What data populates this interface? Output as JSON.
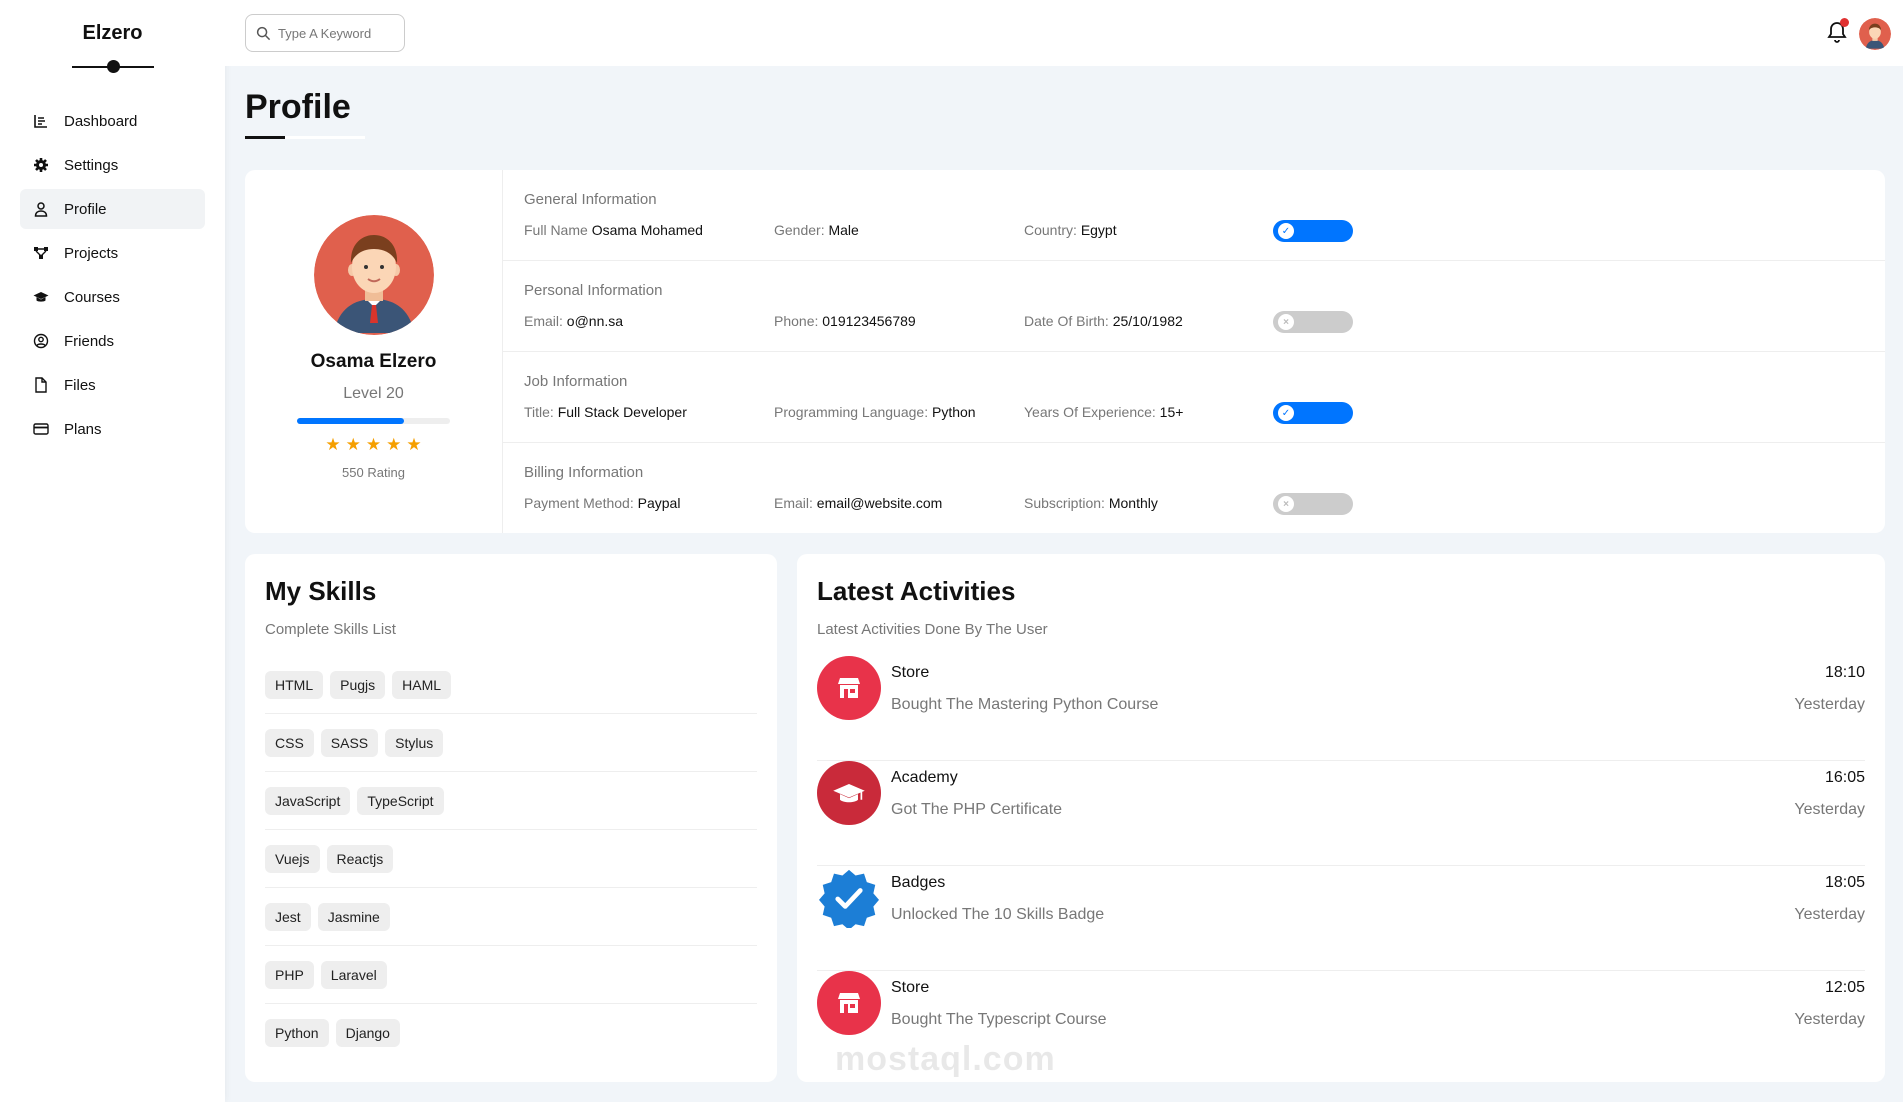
{
  "sidebar": {
    "brand": "Elzero",
    "items": [
      {
        "label": "Dashboard",
        "icon": "chart-icon"
      },
      {
        "label": "Settings",
        "icon": "gear-icon"
      },
      {
        "label": "Profile",
        "icon": "user-icon"
      },
      {
        "label": "Projects",
        "icon": "diagram-icon"
      },
      {
        "label": "Courses",
        "icon": "graduation-cap-icon"
      },
      {
        "label": "Friends",
        "icon": "circle-user-icon"
      },
      {
        "label": "Files",
        "icon": "file-icon"
      },
      {
        "label": "Plans",
        "icon": "credit-card-icon"
      }
    ],
    "active": "Profile"
  },
  "header": {
    "search_placeholder": "Type A Keyword",
    "notification_dot_color": "#e03131"
  },
  "page": {
    "title": "Profile"
  },
  "profile": {
    "name": "Osama Elzero",
    "level": "Level 20",
    "level_progress": 0.7,
    "stars": 5,
    "rating": "550 Rating"
  },
  "info": {
    "general": {
      "heading": "General Information",
      "f1_label": "Full Name",
      "f1_value": "Osama Mohamed",
      "f2_label": "Gender:",
      "f2_value": "Male",
      "f3_label": "Country:",
      "f3_value": "Egypt",
      "toggle_on": true
    },
    "personal": {
      "heading": "Personal Information",
      "f1_label": "Email:",
      "f1_value": "o@nn.sa",
      "f2_label": "Phone:",
      "f2_value": "019123456789",
      "f3_label": "Date Of Birth:",
      "f3_value": "25/10/1982",
      "toggle_on": false
    },
    "job": {
      "heading": "Job Information",
      "f1_label": "Title:",
      "f1_value": "Full Stack Developer",
      "f2_label": "Programming Language:",
      "f2_value": "Python",
      "f3_label": "Years Of Experience:",
      "f3_value": "15+",
      "toggle_on": true
    },
    "billing": {
      "heading": "Billing Information",
      "f1_label": "Payment Method:",
      "f1_value": "Paypal",
      "f2_label": "Email:",
      "f2_value": "email@website.com",
      "f3_label": "Subscription:",
      "f3_value": "Monthly",
      "toggle_on": false
    }
  },
  "skills": {
    "title": "My Skills",
    "subtitle": "Complete Skills List",
    "rows": [
      [
        "HTML",
        "Pugjs",
        "HAML"
      ],
      [
        "CSS",
        "SASS",
        "Stylus"
      ],
      [
        "JavaScript",
        "TypeScript"
      ],
      [
        "Vuejs",
        "Reactjs"
      ],
      [
        "Jest",
        "Jasmine"
      ],
      [
        "PHP",
        "Laravel"
      ],
      [
        "Python",
        "Django"
      ]
    ]
  },
  "activities": {
    "title": "Latest Activities",
    "subtitle": "Latest Activities Done By The User",
    "items": [
      {
        "title": "Store",
        "desc": "Bought The Mastering Python Course",
        "time": "18:10",
        "day": "Yesterday",
        "icon": "store-icon",
        "color": "#e8334a"
      },
      {
        "title": "Academy",
        "desc": "Got The PHP Certificate",
        "time": "16:05",
        "day": "Yesterday",
        "icon": "graduation-cap-icon",
        "color": "#c92a3a"
      },
      {
        "title": "Badges",
        "desc": "Unlocked The 10 Skills Badge",
        "time": "18:05",
        "day": "Yesterday",
        "icon": "verified-badge-icon",
        "color": "#1c7ed6"
      },
      {
        "title": "Store",
        "desc": "Bought The Typescript Course",
        "time": "12:05",
        "day": "Yesterday",
        "icon": "store-icon",
        "color": "#e8334a"
      }
    ]
  },
  "watermark": "mostaql.com"
}
